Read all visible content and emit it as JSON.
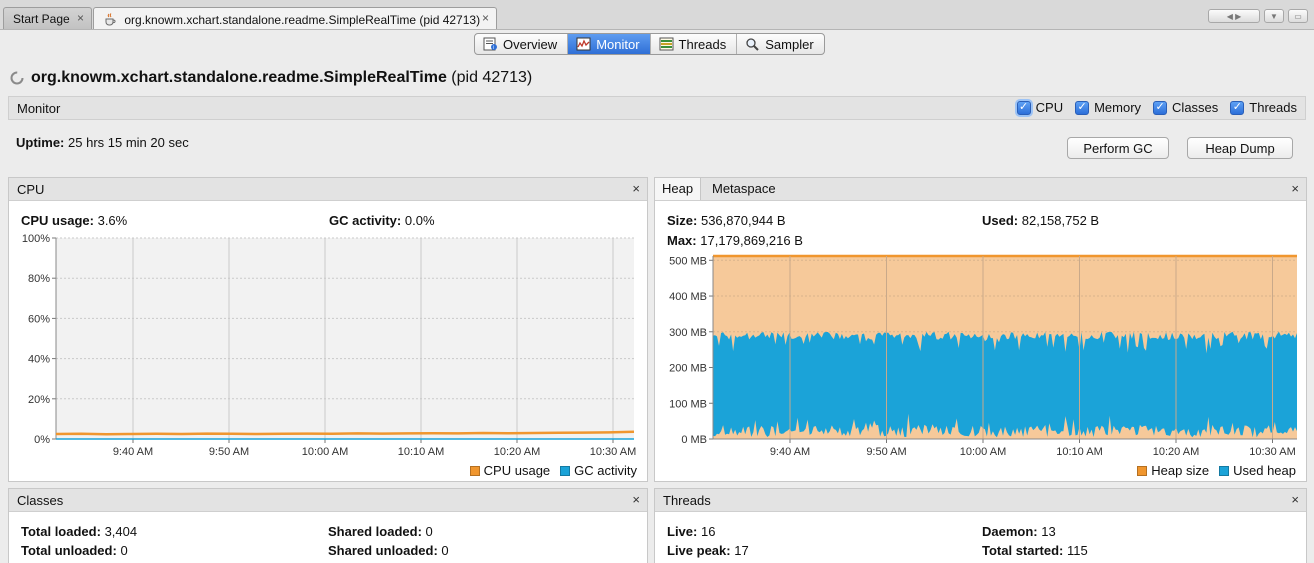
{
  "doc_tabs": [
    {
      "label": "Start Page"
    },
    {
      "label": "org.knowm.xchart.standalone.readme.SimpleRealTime (pid 42713)"
    }
  ],
  "close_glyph": "×",
  "view_tabs": [
    "Overview",
    "Monitor",
    "Threads",
    "Sampler"
  ],
  "title": {
    "app": "org.knowm.xchart.standalone.readme.SimpleRealTime",
    "pid": "(pid 42713)"
  },
  "monitor": {
    "label": "Monitor",
    "checkboxes": [
      "CPU",
      "Memory",
      "Classes",
      "Threads"
    ],
    "uptime_label": "Uptime:",
    "uptime_value": "25 hrs 15 min 20 sec",
    "perform_gc": "Perform GC",
    "heap_dump": "Heap Dump"
  },
  "cpu_panel": {
    "title": "CPU",
    "cpu_usage_label": "CPU usage:",
    "cpu_usage_value": "3.6%",
    "gc_activity_label": "GC activity:",
    "gc_activity_value": "0.0%",
    "legend": [
      "CPU usage",
      "GC activity"
    ]
  },
  "heap_panel": {
    "tabs": [
      "Heap",
      "Metaspace"
    ],
    "size_label": "Size:",
    "size_value": "536,870,944 B",
    "used_label": "Used:",
    "used_value": "82,158,752 B",
    "max_label": "Max:",
    "max_value": "17,179,869,216 B",
    "legend": [
      "Heap size",
      "Used heap"
    ]
  },
  "classes_panel": {
    "title": "Classes",
    "total_loaded_label": "Total loaded:",
    "total_loaded_value": "3,404",
    "total_unloaded_label": "Total unloaded:",
    "total_unloaded_value": "0",
    "shared_loaded_label": "Shared loaded:",
    "shared_loaded_value": "0",
    "shared_unloaded_label": "Shared unloaded:",
    "shared_unloaded_value": "0"
  },
  "threads_panel": {
    "title": "Threads",
    "live_label": "Live:",
    "live_value": "16",
    "live_peak_label": "Live peak:",
    "live_peak_value": "17",
    "daemon_label": "Daemon:",
    "daemon_value": "13",
    "total_started_label": "Total started:",
    "total_started_value": "115"
  },
  "colors": {
    "orange": "#f0962e",
    "blue": "#1ba3d8",
    "heap_fill": "#f6c99a",
    "plot_bg": "#f2f2f2",
    "accent": "#2f6fd6"
  },
  "chart_data": [
    {
      "type": "line",
      "title": "CPU",
      "x_ticks": [
        "9:40 AM",
        "9:50 AM",
        "10:00 AM",
        "10:10 AM",
        "10:20 AM",
        "10:30 AM"
      ],
      "y_ticks": [
        "100%",
        "80%",
        "60%",
        "40%",
        "20%",
        "0%"
      ],
      "ylim": [
        0,
        100
      ],
      "grid": true,
      "legend_position": "bottom-right",
      "series": [
        {
          "name": "CPU usage",
          "color": "#f0962e",
          "values": [
            2.5,
            2.6,
            2.4,
            2.5,
            2.6,
            2.5,
            2.7,
            2.6,
            2.5,
            2.6,
            2.7,
            2.6,
            2.8,
            2.7,
            2.8,
            2.9,
            2.8,
            3.0,
            2.9,
            3.0,
            3.1,
            3.2,
            3.3,
            3.6
          ]
        },
        {
          "name": "GC activity",
          "color": "#1ba3d8",
          "values": [
            0,
            0,
            0,
            0,
            0,
            0,
            0,
            0,
            0,
            0,
            0,
            0,
            0,
            0,
            0,
            0,
            0,
            0,
            0,
            0,
            0,
            0,
            0,
            0
          ]
        }
      ]
    },
    {
      "type": "area",
      "title": "Heap",
      "x_ticks": [
        "9:40 AM",
        "9:50 AM",
        "10:00 AM",
        "10:10 AM",
        "10:20 AM",
        "10:30 AM"
      ],
      "y_ticks": [
        "500 MB",
        "400 MB",
        "300 MB",
        "200 MB",
        "100 MB",
        "0 MB"
      ],
      "ylim": [
        0,
        512
      ],
      "grid": true,
      "legend_position": "bottom-right",
      "series": [
        {
          "name": "Heap size",
          "color": "#f0962e",
          "values": [
            512,
            512,
            512,
            512,
            512,
            512,
            512,
            512,
            512,
            512,
            512,
            512
          ]
        },
        {
          "name": "Used heap",
          "color": "#1ba3d8",
          "values_range_mb": [
            20,
            300
          ]
        }
      ]
    }
  ]
}
